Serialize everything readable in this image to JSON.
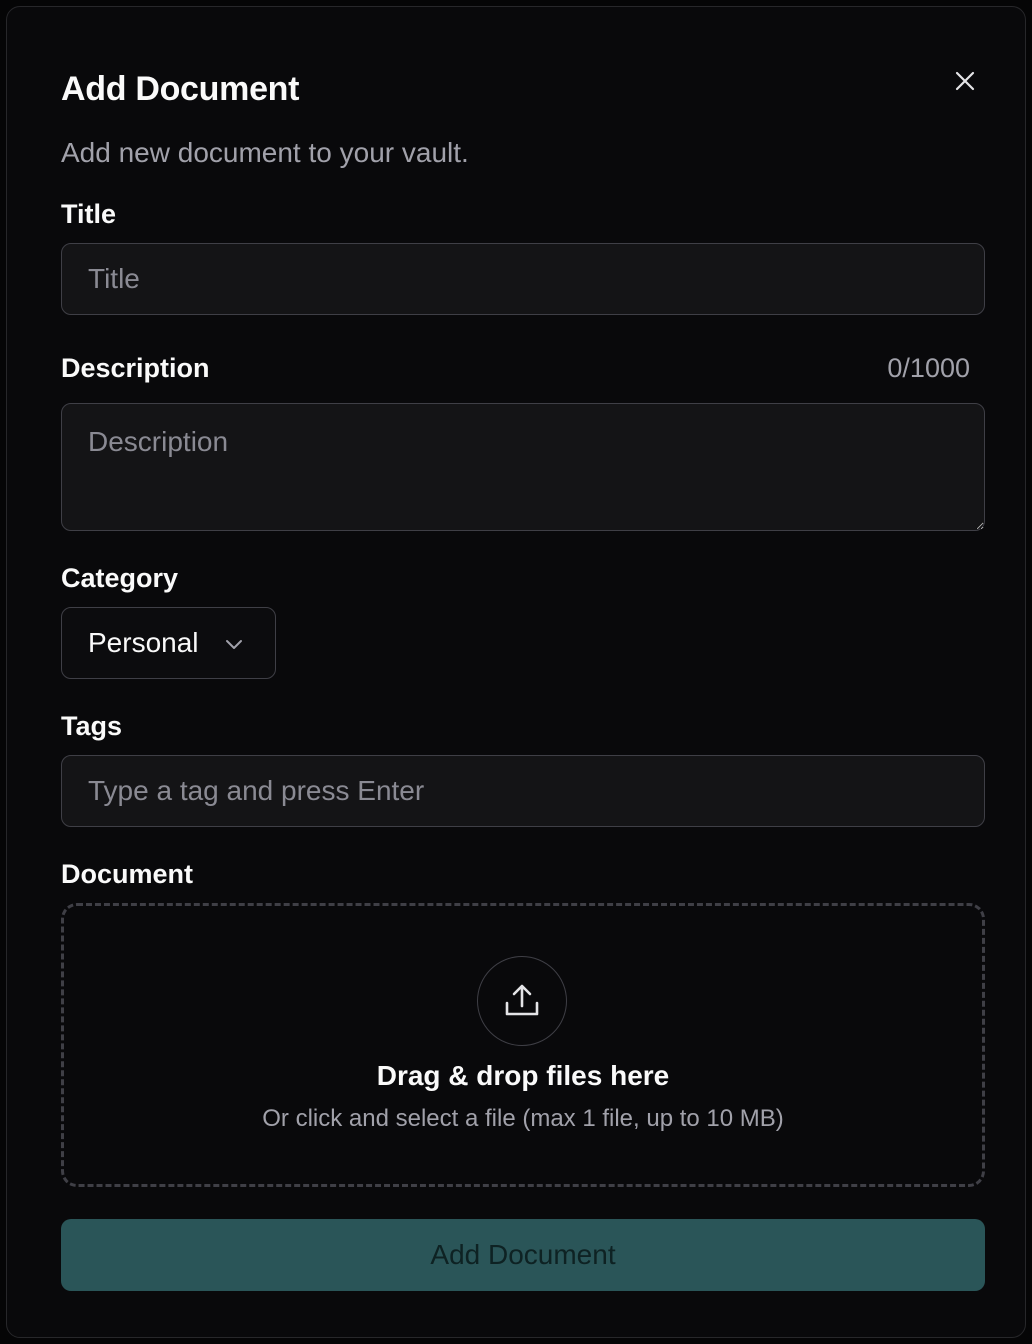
{
  "dialog": {
    "title": "Add Document",
    "subtitle": "Add new document to your vault."
  },
  "fields": {
    "title": {
      "label": "Title",
      "value": "",
      "placeholder": "Title"
    },
    "description": {
      "label": "Description",
      "value": "",
      "placeholder": "Description",
      "counter": "0/1000"
    },
    "category": {
      "label": "Category",
      "value": "Personal"
    },
    "tags": {
      "label": "Tags",
      "value": "",
      "placeholder": "Type a tag and press Enter"
    },
    "document": {
      "label": "Document",
      "dropzone_title": "Drag & drop files here",
      "dropzone_hint": "Or click and select a file (max 1 file, up to 10 MB)"
    }
  },
  "submit_label": "Add Document",
  "icons": {
    "close": "close-icon",
    "chevron": "chevron-down-icon",
    "upload": "upload-icon"
  },
  "colors": {
    "background": "#09090b",
    "border": "#3f3f46",
    "input_bg": "#141416",
    "submit_bg": "#2a5558",
    "submit_text": "#0e2223",
    "muted_text": "#a1a1aa"
  }
}
